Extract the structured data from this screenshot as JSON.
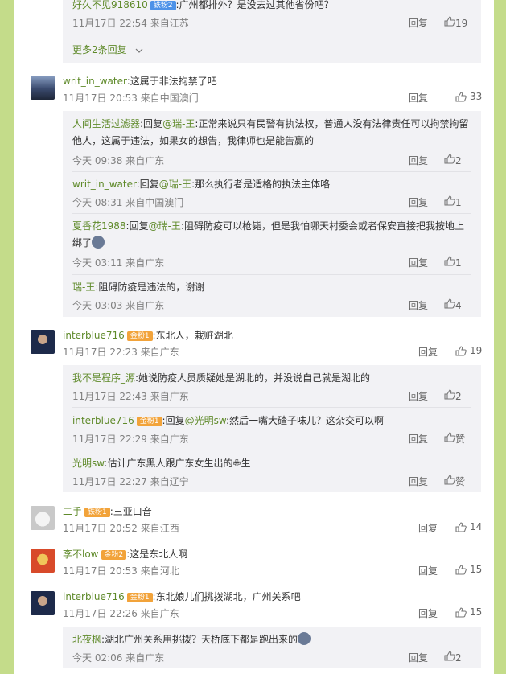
{
  "top_group": {
    "reply": {
      "user": "好久不见918610",
      "badge": "铁粉2",
      "text": ":广州都排外？是没去过其他省份吧？",
      "time": "11月17日 22:54",
      "location": "来自江苏",
      "reply_label": "回复",
      "likes": "19"
    },
    "more": "更多2条回复"
  },
  "comments": [
    {
      "user": "writ_in_water",
      "text": ":这属于非法拘禁了吧",
      "time": "11月17日 20:53",
      "location": "来自中国澳门",
      "reply_label": "回复",
      "likes": "33",
      "replies": [
        {
          "user": "人间生活过滤器",
          "prefix": ":回复",
          "at": "@瑞-王",
          "text": ":正常来说只有民警有执法权，普通人没有法律责任可以拘禁拘留他人，这属于违法，如果女的想告，我律师也是能告赢的",
          "time": "今天 09:38",
          "location": "来自广东",
          "reply_label": "回复",
          "likes": "2"
        },
        {
          "user": "writ_in_water",
          "prefix": ":回复",
          "at": "@瑞-王",
          "text": ":那么执行者是适格的执法主体咯",
          "time": "今天 08:31",
          "location": "来自中国澳门",
          "reply_label": "回复",
          "likes": "1"
        },
        {
          "user": "夏香花1988",
          "prefix": ":回复",
          "at": "@瑞-王",
          "text": ":阻碍防疫可以枪毙，但是我怕哪天村委会或者保安直接把我按地上绑了",
          "time": "今天 03:11",
          "location": "来自广东",
          "reply_label": "回复",
          "likes": "1"
        },
        {
          "user": "瑞-王",
          "prefix": "",
          "at": "",
          "text": ":阻碍防疫是违法的，谢谢",
          "time": "今天 03:03",
          "location": "来自广东",
          "reply_label": "回复",
          "likes": "4"
        }
      ]
    },
    {
      "user": "interblue716",
      "badge": "金粉1",
      "text": ":东北人，栽赃湖北",
      "time": "11月17日 22:23",
      "location": "来自广东",
      "reply_label": "回复",
      "likes": "19",
      "replies": [
        {
          "user": "我不是程序_源",
          "prefix": "",
          "at": "",
          "text": ":她说防疫人员质疑她是湖北的，并没说自己就是湖北的",
          "time": "11月17日 22:43",
          "location": "来自广东",
          "reply_label": "回复",
          "likes": "2"
        },
        {
          "user": "interblue716",
          "badge": "金粉1",
          "prefix": ":回复",
          "at": "@光明sw",
          "text": ":然后一嘴大碴子味儿？这杂交可以啊",
          "time": "11月17日 22:29",
          "location": "来自广东",
          "reply_label": "回复",
          "likes": "赞"
        },
        {
          "user": "光明sw",
          "prefix": "",
          "at": "",
          "text": ":估计广东黑人跟广东女生出的✙生",
          "time": "11月17日 22:27",
          "location": "来自辽宁",
          "reply_label": "回复",
          "likes": "赞"
        }
      ]
    },
    {
      "user": "二手",
      "badge": "铁粉1",
      "text": ":三亚口音",
      "time": "11月17日 20:52",
      "location": "来自江西",
      "reply_label": "回复",
      "likes": "14"
    },
    {
      "user": "李不low",
      "badge": "金粉2",
      "text": ":这是东北人啊",
      "time": "11月17日 20:53",
      "location": "来自河北",
      "reply_label": "回复",
      "likes": "15"
    },
    {
      "user": "interblue716",
      "badge": "金粉1",
      "text": ":东北娘儿们挑拨湖北，广州关系吧",
      "time": "11月17日 22:26",
      "location": "来自广东",
      "reply_label": "回复",
      "likes": "15",
      "replies": [
        {
          "user": "北夜枫",
          "prefix": "",
          "at": "",
          "text": ":湖北广州关系用挑拨？天桥底下都是跑出来的",
          "time": "今天 02:06",
          "location": "来自广东",
          "reply_label": "回复",
          "likes": "2"
        }
      ]
    }
  ],
  "colors": {
    "page_bg": "#c4dc8a",
    "username": "#5f8a2a",
    "reply_bg": "#f2f2f5",
    "meta": "#808080"
  },
  "icons": [
    "thumbs-up-icon",
    "chevron-down-icon",
    "avatar"
  ]
}
